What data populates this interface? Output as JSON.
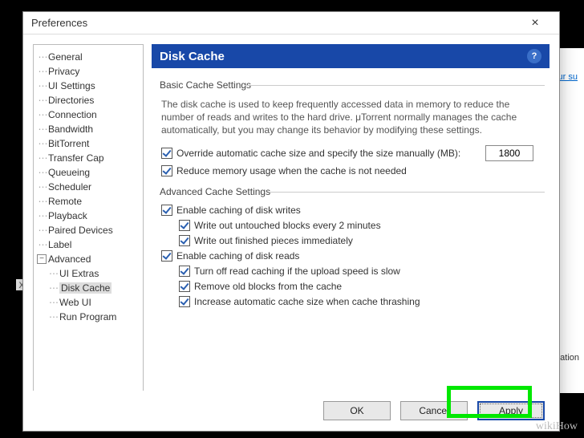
{
  "window": {
    "title": "Preferences"
  },
  "bg": {
    "link": "our su",
    "text": "ation",
    "close": "x"
  },
  "tree": {
    "items": [
      {
        "label": "General"
      },
      {
        "label": "Privacy"
      },
      {
        "label": "UI Settings"
      },
      {
        "label": "Directories"
      },
      {
        "label": "Connection"
      },
      {
        "label": "Bandwidth"
      },
      {
        "label": "BitTorrent"
      },
      {
        "label": "Transfer Cap"
      },
      {
        "label": "Queueing"
      },
      {
        "label": "Scheduler"
      },
      {
        "label": "Remote"
      },
      {
        "label": "Playback"
      },
      {
        "label": "Paired Devices"
      },
      {
        "label": "Label"
      }
    ],
    "advanced_label": "Advanced",
    "sub": [
      {
        "label": "UI Extras"
      },
      {
        "label": "Disk Cache"
      },
      {
        "label": "Web UI"
      },
      {
        "label": "Run Program"
      }
    ]
  },
  "banner": {
    "title": "Disk Cache",
    "help": "?"
  },
  "basic": {
    "heading": "Basic Cache Settings",
    "desc": "The disk cache is used to keep frequently accessed data in memory to reduce the number of reads and writes to the hard drive. μTorrent normally manages the cache automatically, but you may change its behavior by modifying these settings.",
    "override": "Override automatic cache size and specify the size manually (MB):",
    "override_val": "1800",
    "reduce": "Reduce memory usage when the cache is not needed"
  },
  "advanced": {
    "heading": "Advanced Cache Settings",
    "enable_writes": "Enable caching of disk writes",
    "write_untouched": "Write out untouched blocks every 2 minutes",
    "write_finished": "Write out finished pieces immediately",
    "enable_reads": "Enable caching of disk reads",
    "turn_off": "Turn off read caching if the upload speed is slow",
    "remove_old": "Remove old blocks from the cache",
    "increase": "Increase automatic cache size when cache thrashing"
  },
  "buttons": {
    "ok": "OK",
    "cancel": "Cancel",
    "apply": "Apply"
  },
  "watermark": "wikiHow"
}
